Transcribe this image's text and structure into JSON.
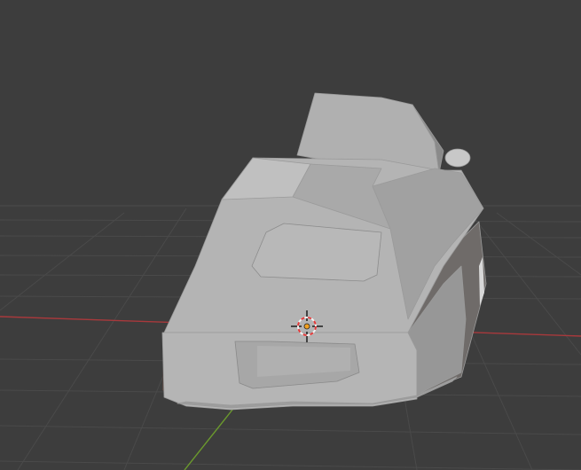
{
  "viewport": {
    "background_color": "#3d3d3d",
    "grid_color": "#4a4a4a",
    "x_axis_color": "#a8393c",
    "y_axis_color": "#6b9a2d"
  },
  "scene": {
    "object_shape": "low-poly car model (front view, gray solid shading)",
    "object_color": "#b7b7b7",
    "object_shade_color": "#7e7e7e",
    "underside_color": "#5a4a45"
  },
  "cursor": {
    "icon": "3d-cursor-icon",
    "ring_colors": [
      "#e23a3a",
      "#f2f2f2"
    ]
  }
}
